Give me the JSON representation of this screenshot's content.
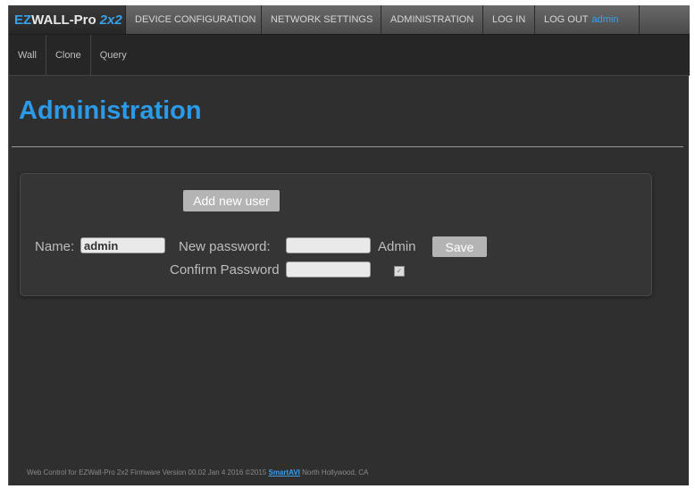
{
  "brand": {
    "first": "EZ",
    "rest": "WALL-Pro",
    "model": "2x2"
  },
  "nav": {
    "device_configuration": "DEVICE CONFIGURATION",
    "network_settings": "NETWORK SETTINGS",
    "administration": "ADMINISTRATION",
    "log_in": "LOG IN",
    "log_out": "LOG OUT",
    "user": "admin"
  },
  "subnav": {
    "wall": "Wall",
    "clone": "Clone",
    "query": "Query"
  },
  "page": {
    "title": "Administration"
  },
  "form": {
    "add_user_button": "Add new user",
    "name_label": "Name:",
    "name_value": "admin",
    "new_password_label": "New password:",
    "new_password_value": "",
    "confirm_password_label": "Confirm Password",
    "confirm_password_value": "",
    "admin_label": "Admin",
    "admin_checked": true,
    "save_button": "Save"
  },
  "footer": {
    "text_before": "Web Control for EZWall-Pro 2x2   Firmware Version 00.02 Jan 4 2016   ©2015",
    "link": "SmartAVI",
    "text_after": " North Hollywood, CA"
  },
  "colors": {
    "accent": "#2b9ae8",
    "background": "#2f2f2f",
    "button": "#b4b4b4"
  }
}
